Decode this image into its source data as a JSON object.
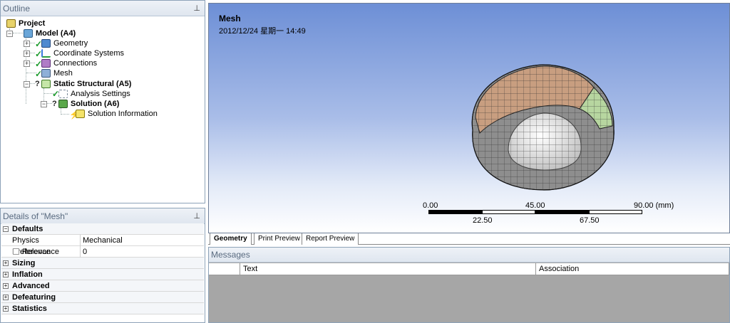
{
  "outline": {
    "title": "Outline",
    "pin": "ₐ",
    "tree": {
      "project": "Project",
      "model": "Model (A4)",
      "geometry": "Geometry",
      "coordinate_systems": "Coordinate Systems",
      "connections": "Connections",
      "mesh": "Mesh",
      "static_structural": "Static Structural (A5)",
      "analysis_settings": "Analysis Settings",
      "solution": "Solution (A6)",
      "solution_information": "Solution Information",
      "qmark": "?"
    }
  },
  "details": {
    "title": "Details of \"Mesh\"",
    "groups": {
      "defaults": "Defaults",
      "sizing": "Sizing",
      "inflation": "Inflation",
      "advanced": "Advanced",
      "defeaturing": "Defeaturing",
      "statistics": "Statistics"
    },
    "rows": {
      "physics_preference": {
        "key": "Physics Preference",
        "value": "Mechanical"
      },
      "relevance": {
        "key": "Relevance",
        "value": "0"
      }
    },
    "expand_minus": "−",
    "expand_plus": "+"
  },
  "viewport": {
    "title": "Mesh",
    "date": "2012/12/24 星期一 14:49",
    "scalebar": {
      "top_labels": [
        "0.00",
        "45.00",
        "90.00 (mm)"
      ],
      "bottom_labels": [
        "22.50",
        "67.50"
      ]
    }
  },
  "tabs": [
    "Geometry",
    "Print Preview",
    "Report Preview"
  ],
  "messages": {
    "title": "Messages",
    "columns": [
      "Text",
      "Association"
    ]
  },
  "colors": {
    "tan_face": "#c89e80",
    "green_face": "#b7d6a0",
    "gray_mesh": "#8e8e8e",
    "inner_white": "#e8e8e8"
  }
}
